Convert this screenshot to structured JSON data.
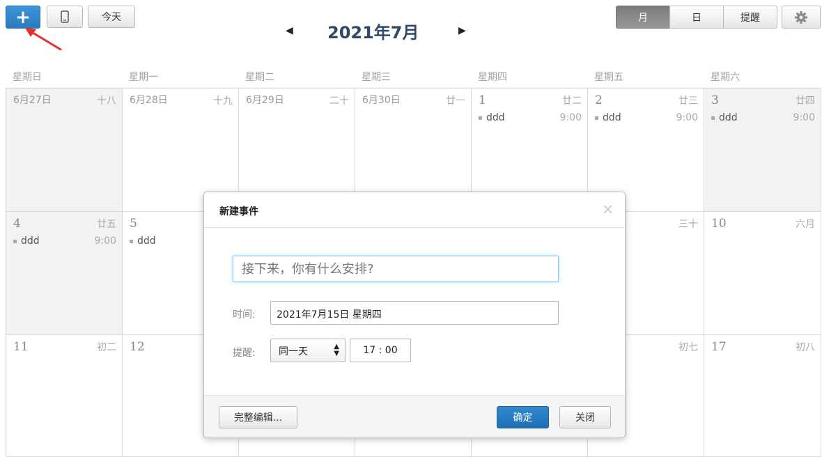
{
  "toolbar": {
    "add_label": "+",
    "today_label": "今天",
    "view_month": "月",
    "view_day": "日",
    "view_reminder": "提醒"
  },
  "header": {
    "title": "2021年7月",
    "prev": "◀",
    "next": "▶"
  },
  "weekdays": [
    "星期日",
    "星期一",
    "星期二",
    "星期三",
    "星期四",
    "星期五",
    "星期六"
  ],
  "weeks": [
    [
      {
        "day": "6月27日",
        "lunar": "十八",
        "gray": true
      },
      {
        "day": "6月28日",
        "lunar": "十九"
      },
      {
        "day": "6月29日",
        "lunar": "二十"
      },
      {
        "day": "6月30日",
        "lunar": "廿一"
      },
      {
        "day": "1",
        "lunar": "廿二",
        "event": "ddd",
        "time": "9:00"
      },
      {
        "day": "2",
        "lunar": "廿三",
        "event": "ddd",
        "time": "9:00"
      },
      {
        "day": "3",
        "lunar": "廿四",
        "event": "ddd",
        "time": "9:00",
        "gray": true
      }
    ],
    [
      {
        "day": "4",
        "lunar": "廿五",
        "event": "ddd",
        "time": "9:00",
        "gray": true
      },
      {
        "day": "5",
        "lunar": "",
        "event": "ddd",
        "time": ""
      },
      {
        "day": "",
        "lunar": ""
      },
      {
        "day": "",
        "lunar": ""
      },
      {
        "day": "",
        "lunar": ""
      },
      {
        "day": "",
        "lunar": "三十"
      },
      {
        "day": "10",
        "lunar": "六月"
      }
    ],
    [
      {
        "day": "11",
        "lunar": "初二"
      },
      {
        "day": "12",
        "lunar": ""
      },
      {
        "day": "",
        "lunar": ""
      },
      {
        "day": "",
        "lunar": ""
      },
      {
        "day": "",
        "lunar": ""
      },
      {
        "day": "",
        "lunar": "初七"
      },
      {
        "day": "17",
        "lunar": "初八"
      }
    ]
  ],
  "modal": {
    "title": "新建事件",
    "close_icon": "×",
    "event_placeholder": "接下来，你有什么安排?",
    "time_label": "时间:",
    "date_value": "2021年7月15日 星期四",
    "remind_label": "提醒:",
    "remind_option": "同一天",
    "remind_time": "17 :  00",
    "full_edit_label": "完整编辑...",
    "ok_label": "确定",
    "close_label": "关闭"
  },
  "colors": {
    "accent": "#2a7bc0",
    "pointer": "#e8312a",
    "title": "#2e4a66"
  }
}
